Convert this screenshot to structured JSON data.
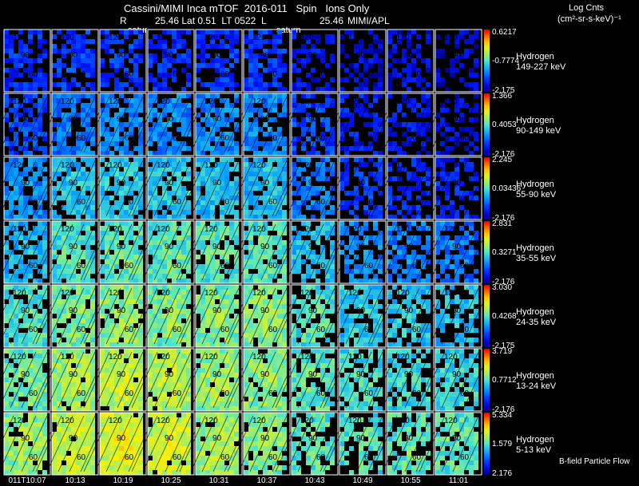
{
  "header": {
    "line1": "Cassini/MIMI Inca mTOF  2016-011   Spin   Ions Only",
    "r_label": "R",
    "r_val": "25.46 Lat 0.51  LT 0522  L",
    "l_val": "25.46",
    "org": "MIMI/APL",
    "units_title": "Log Cnts",
    "units": "(cm²-sr-s-keV)⁻¹",
    "saturn_labels": [
      "satur",
      "saturn"
    ]
  },
  "footer": {
    "bfield_note": "B-field Particle Flow"
  },
  "chart_data": {
    "type": "heatmap",
    "x_tick_labels": [
      "011T10:07",
      "10:13",
      "10:19",
      "10:25",
      "10:31",
      "10:37",
      "10:43",
      "10:49",
      "10:55",
      "11:01"
    ],
    "overlay_contour_labels": [
      "120",
      "90",
      "60"
    ],
    "rows": [
      {
        "species": "Hydrogen",
        "energy": "149-227 keV",
        "cbar_max": "0.6217",
        "cbar_mid": "-0.7774",
        "cbar_min": "-2.175",
        "intensity": [
          0.18,
          0.2,
          0.19,
          0.17,
          0.19,
          0.2,
          0.12,
          0.1,
          0.1,
          0.08
        ]
      },
      {
        "species": "Hydrogen",
        "energy": "90-149 keV",
        "cbar_max": "1.366",
        "cbar_mid": "0.4053",
        "cbar_min": "-2.176",
        "intensity": [
          0.22,
          0.3,
          0.32,
          0.32,
          0.32,
          0.33,
          0.22,
          0.15,
          0.13,
          0.11
        ]
      },
      {
        "species": "Hydrogen",
        "energy": "55-90 keV",
        "cbar_max": "2.245",
        "cbar_mid": "0.03436",
        "cbar_min": "-2.176",
        "intensity": [
          0.33,
          0.42,
          0.44,
          0.43,
          0.42,
          0.42,
          0.3,
          0.2,
          0.18,
          0.16
        ]
      },
      {
        "species": "Hydrogen",
        "energy": "35-55 keV",
        "cbar_max": "2.831",
        "cbar_mid": "0.3271",
        "cbar_min": "-2.176",
        "intensity": [
          0.4,
          0.5,
          0.52,
          0.52,
          0.52,
          0.52,
          0.42,
          0.33,
          0.32,
          0.3
        ]
      },
      {
        "species": "Hydrogen",
        "energy": "24-35 keV",
        "cbar_max": "3.030",
        "cbar_mid": "0.4268",
        "cbar_min": "-2.175",
        "intensity": [
          0.5,
          0.56,
          0.58,
          0.57,
          0.57,
          0.58,
          0.5,
          0.44,
          0.43,
          0.42
        ]
      },
      {
        "species": "Hydrogen",
        "energy": "13-24 keV",
        "cbar_max": "3.719",
        "cbar_mid": "0.7712",
        "cbar_min": "-2.176",
        "intensity": [
          0.55,
          0.62,
          0.66,
          0.64,
          0.6,
          0.58,
          0.52,
          0.48,
          0.47,
          0.47
        ]
      },
      {
        "species": "Hydrogen",
        "energy": "5-13 keV",
        "cbar_max": "5.334",
        "cbar_mid": "1.579",
        "cbar_min": "2.176",
        "intensity": [
          0.6,
          0.66,
          0.7,
          0.68,
          0.62,
          0.57,
          0.52,
          0.5,
          0.52,
          0.52
        ]
      }
    ]
  }
}
